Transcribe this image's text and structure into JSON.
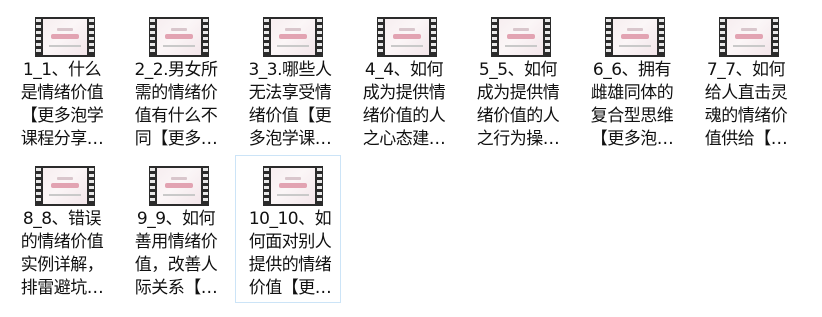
{
  "files": [
    {
      "line1": "1_1、什么",
      "line2": "是情绪价值",
      "line3": "【更多泡学",
      "line4": "课程分享…",
      "selected": false
    },
    {
      "line1": "2_2.男女所",
      "line2": "需的情绪价",
      "line3": "值有什么不",
      "line4": "同【更多…",
      "selected": false
    },
    {
      "line1": "3_3.哪些人",
      "line2": "无法享受情",
      "line3": "绪价值【更",
      "line4": "多泡学课…",
      "selected": false
    },
    {
      "line1": "4_4、如何",
      "line2": "成为提供情",
      "line3": "绪价值的人",
      "line4": "之心态建…",
      "selected": false
    },
    {
      "line1": "5_5、如何",
      "line2": "成为提供情",
      "line3": "绪价值的人",
      "line4": "之行为操…",
      "selected": false
    },
    {
      "line1": "6_6、拥有",
      "line2": "雌雄同体的",
      "line3": "复合型思维",
      "line4": "【更多泡…",
      "selected": false
    },
    {
      "line1": "7_7、如何",
      "line2": "给人直击灵",
      "line3": "魂的情绪价",
      "line4": "值供给【…",
      "selected": false
    },
    {
      "line1": "8_8、错误",
      "line2": "的情绪价值",
      "line3": "实例详解，",
      "line4": "排雷避坑…",
      "selected": false
    },
    {
      "line1": "9_9、如何",
      "line2": "善用情绪价",
      "line3": "值，改善人",
      "line4": "际关系【…",
      "selected": false
    },
    {
      "line1": "10_10、如",
      "line2": "何面对别人",
      "line3": "提供的情绪",
      "line4": "价值【更…",
      "selected": true
    }
  ]
}
